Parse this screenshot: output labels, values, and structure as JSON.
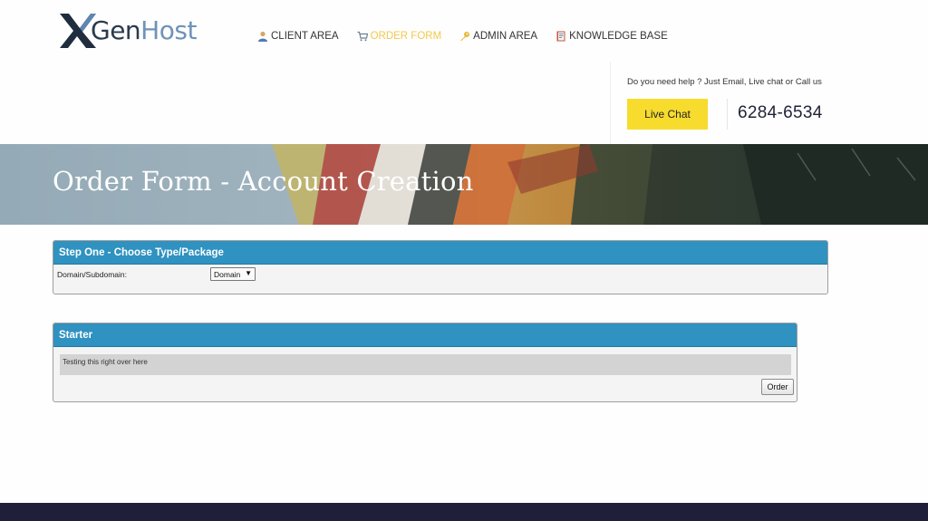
{
  "brand": {
    "gen": "Gen",
    "host": "Host"
  },
  "nav": {
    "items": [
      {
        "label": "CLIENT AREA",
        "icon": "user-icon",
        "active": false
      },
      {
        "label": "ORDER FORM",
        "icon": "cart-icon",
        "active": true
      },
      {
        "label": "ADMIN AREA",
        "icon": "key-icon",
        "active": false
      },
      {
        "label": "KNOWLEDGE BASE",
        "icon": "book-icon",
        "active": false
      }
    ]
  },
  "help": {
    "text": "Do you need help ? Just Email, Live chat or Call us",
    "live_chat_label": "Live Chat",
    "phone": "6284-6534"
  },
  "hero": {
    "title": "Order Form - Account Creation"
  },
  "step_one": {
    "title": "Step One - Choose Type/Package",
    "field_label": "Domain/Subdomain:",
    "select_value": "Domain"
  },
  "package": {
    "name": "Starter",
    "description": "Testing this right over here",
    "order_label": "Order"
  },
  "colors": {
    "accent_yellow": "#f7dc2e",
    "panel_blue": "#2f92c0",
    "active_nav": "#f2c94c",
    "footer": "#1f1f3a"
  }
}
